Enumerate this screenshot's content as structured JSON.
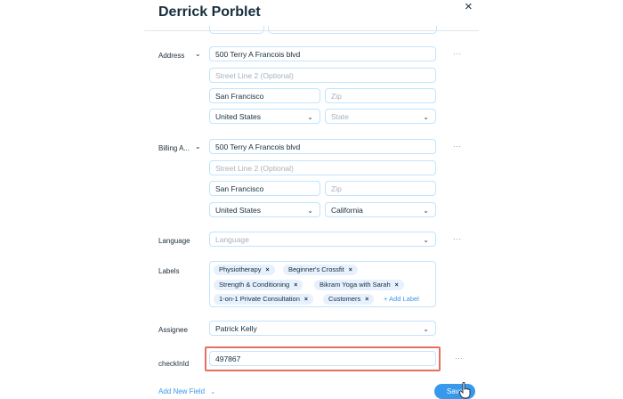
{
  "header": {
    "title": "Derrick Porblet"
  },
  "address": {
    "label": "Address",
    "street1": "500 Terry A Francois blvd",
    "street2_placeholder": "Street Line 2 (Optional)",
    "city": "San Francisco",
    "zip_placeholder": "Zip",
    "country": "United States",
    "state_placeholder": "State"
  },
  "billing": {
    "label": "Billing A...",
    "street1": "500 Terry A Francois blvd",
    "street2_placeholder": "Street Line 2 (Optional)",
    "city": "San Francisco",
    "zip_placeholder": "Zip",
    "country": "United States",
    "state": "California"
  },
  "language": {
    "label": "Language",
    "placeholder": "Language"
  },
  "labels": {
    "label": "Labels",
    "chips": [
      "Physiotherapy",
      "Beginner's Crossfit",
      "Strength & Conditioning",
      "Bikram Yoga with Sarah",
      "1-on-1 Private Consultation",
      "Customers"
    ],
    "add_label": "+ Add Label"
  },
  "assignee": {
    "label": "Assignee",
    "value": "Patrick Kelly"
  },
  "checkid": {
    "label": "checkInId",
    "value": "497867"
  },
  "footer": {
    "add_field": "Add New Field",
    "save": "Save"
  },
  "icons": {
    "close": "×",
    "chevron": "⌄",
    "more": "···",
    "chip_remove": "×"
  },
  "colors": {
    "accent": "#3899ec",
    "highlight": "#e57061",
    "border": "#c1e4fe"
  }
}
